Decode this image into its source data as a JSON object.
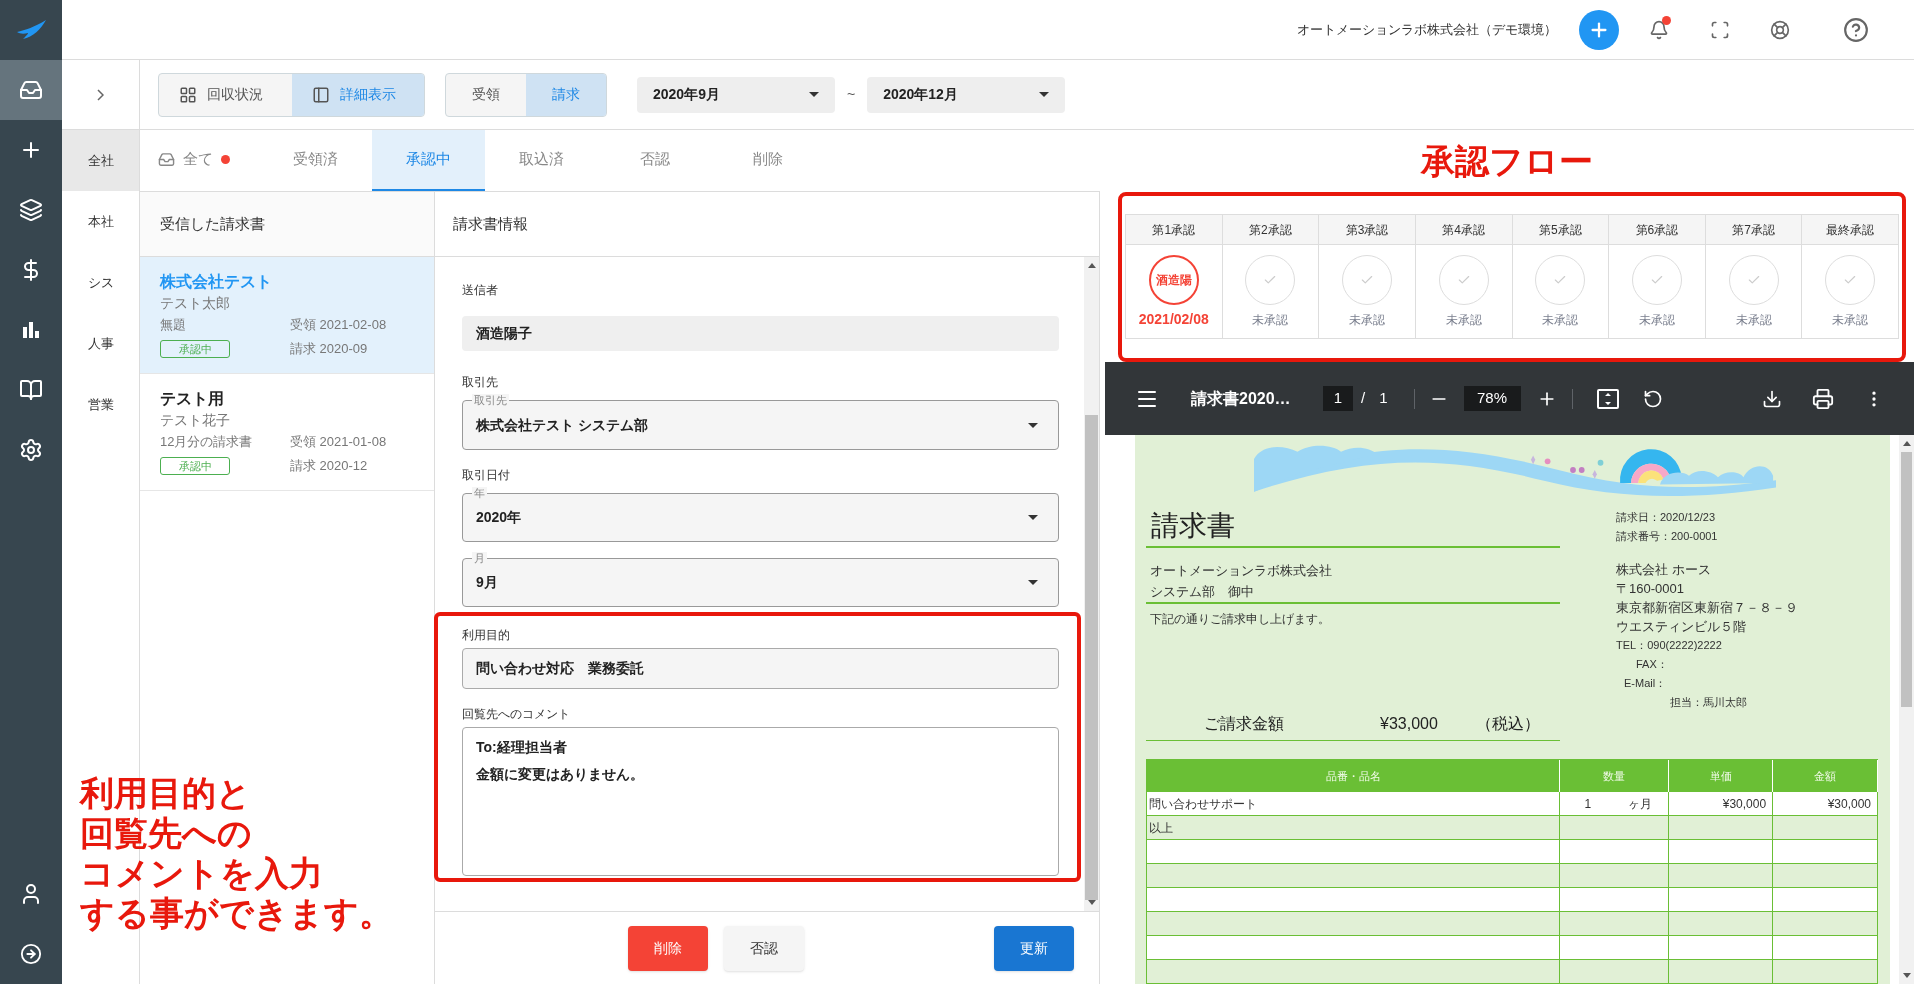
{
  "rail_items": [
    {
      "selected": true
    },
    {
      "selected": false
    },
    {
      "selected": false
    },
    {
      "selected": false
    },
    {
      "selected": false
    },
    {
      "selected": false
    },
    {
      "selected": false
    }
  ],
  "header": {
    "company": "オートメーションラボ株式会社（デモ環境）",
    "has_unread": true
  },
  "toolbar": {
    "view_toggle": [
      {
        "label": "回収状況",
        "selected": false
      },
      {
        "label": "詳細表示",
        "selected": true
      }
    ],
    "direction_toggle": [
      {
        "label": "受領",
        "selected": false
      },
      {
        "label": "請求",
        "selected": true
      }
    ],
    "date_from": "2020年9月",
    "range_separator": "~",
    "date_to": "2020年12月"
  },
  "sub_sidebar": [
    {
      "label": "全社",
      "selected": true
    },
    {
      "label": "本社",
      "selected": false
    },
    {
      "label": "シス",
      "selected": false
    },
    {
      "label": "人事",
      "selected": false
    },
    {
      "label": "営業",
      "selected": false
    }
  ],
  "tabs": [
    {
      "label": "全て",
      "selected": false,
      "unread": true
    },
    {
      "label": "受領済",
      "selected": false,
      "unread": false
    },
    {
      "label": "承認中",
      "selected": true,
      "unread": false
    },
    {
      "label": "取込済",
      "selected": false,
      "unread": false
    },
    {
      "label": "否認",
      "selected": false,
      "unread": false
    },
    {
      "label": "削除",
      "selected": false,
      "unread": false
    }
  ],
  "invoice_list": {
    "title": "受信した請求書",
    "items": [
      {
        "company": "株式会社テスト",
        "person": "テスト太郎",
        "subject": "無題",
        "received": "受領 2021-02-08",
        "status": "承認中",
        "billing": "請求 2020-09",
        "selected": true
      },
      {
        "company": "テスト用",
        "person": "テスト花子",
        "subject": "12月分の請求書",
        "received": "受領 2021-01-08",
        "status": "承認中",
        "billing": "請求 2020-12",
        "selected": false
      }
    ]
  },
  "form": {
    "title": "請求書情報",
    "sender_label": "送信者",
    "sender": "酒造陽子",
    "partner_label": "取引先",
    "partner": {
      "label": "取引先",
      "value": "株式会社テスト システム部"
    },
    "date_label": "取引日付",
    "year": {
      "label": "年",
      "value": "2020年"
    },
    "month": {
      "label": "月",
      "value": "9月"
    },
    "purpose_label": "利用目的",
    "purpose": "問い合わせ対応　業務委託",
    "comment_label": "回覧先へのコメント",
    "comment": [
      "To:経理担当者",
      "金額に変更はありません。"
    ],
    "buttons": [
      {
        "label": "削除",
        "kind": "danger"
      },
      {
        "label": "否認",
        "kind": "neutral"
      },
      {
        "label": "更新",
        "kind": "primary"
      }
    ]
  },
  "annotations": {
    "fields_note": [
      "利用目的と",
      "回覧先への",
      "コメントを入力",
      "する事ができます。"
    ],
    "flow_title": "承認フロー"
  },
  "approval_flow": {
    "steps": [
      {
        "label": "第1承認",
        "approved": true,
        "stamp": "酒造陽",
        "date": "2021/02/08"
      },
      {
        "label": "第2承認",
        "approved": false,
        "status": "未承認"
      },
      {
        "label": "第3承認",
        "approved": false,
        "status": "未承認"
      },
      {
        "label": "第4承認",
        "approved": false,
        "status": "未承認"
      },
      {
        "label": "第5承認",
        "approved": false,
        "status": "未承認"
      },
      {
        "label": "第6承認",
        "approved": false,
        "status": "未承認"
      },
      {
        "label": "第7承認",
        "approved": false,
        "status": "未承認"
      },
      {
        "label": "最終承認",
        "approved": false,
        "status": "未承認"
      }
    ]
  },
  "pdf_viewer": {
    "title": "請求書2020…",
    "page": "1",
    "page_separator": "/",
    "page_total": "1",
    "zoom": "78%"
  },
  "document": {
    "title": "請求書",
    "invoice_date": "請求日：2020/12/23",
    "invoice_no": "請求番号：200-0001",
    "recipient": [
      "オートメーションラボ株式会社",
      "システム部　御中"
    ],
    "note": "下記の通りご請求申し上げます。",
    "issuer": [
      "株式会社 ホース",
      "〒160-0001",
      "東京都新宿区東新宿７－８－９",
      "ウエスティンビル５階"
    ],
    "tel": "TEL：090(2222)2222",
    "fax": "FAX：",
    "email": "E-Mail：",
    "contact": "担当：馬川太郎",
    "amount_label": "ご請求金額",
    "amount": "¥33,000",
    "tax_note": "（税込）",
    "columns": [
      "品番・品名",
      "数量",
      "単価",
      "金額"
    ],
    "rows": [
      {
        "name": "問い合わせサポート",
        "qty": "1",
        "unit": "ヶ月",
        "price": "¥30,000",
        "amount": "¥30,000"
      },
      {
        "name": "以上"
      }
    ]
  }
}
